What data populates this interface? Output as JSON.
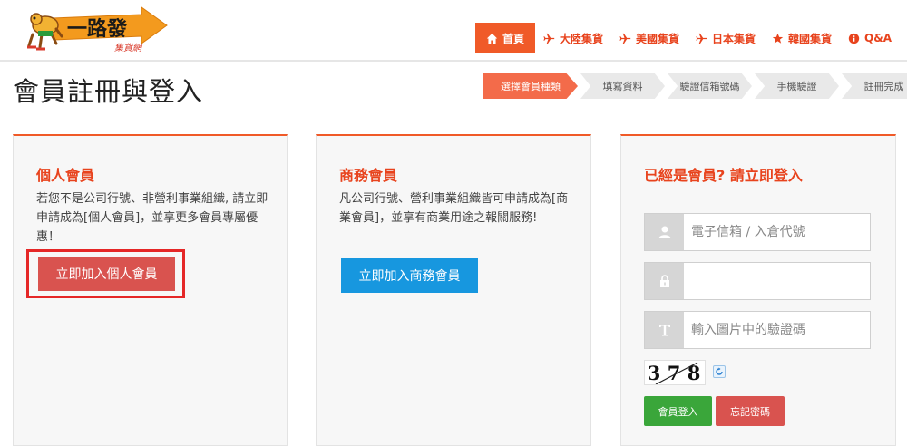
{
  "brand": {
    "logo_text": "一路發",
    "logo_subtext": "集貨網"
  },
  "nav": {
    "items": [
      {
        "label": "首頁",
        "icon": "home-icon",
        "active": true
      },
      {
        "label": "大陸集貨",
        "icon": "plane-icon",
        "active": false
      },
      {
        "label": "美國集貨",
        "icon": "plane-icon",
        "active": false
      },
      {
        "label": "日本集貨",
        "icon": "plane-icon",
        "active": false
      },
      {
        "label": "韓國集貨",
        "icon": "star-icon",
        "active": false
      },
      {
        "label": "Q&A",
        "icon": "info-icon",
        "active": false
      }
    ]
  },
  "page": {
    "title": "會員註冊與登入"
  },
  "steps": [
    {
      "label": "選擇會員種類",
      "active": true
    },
    {
      "label": "填寫資料",
      "active": false
    },
    {
      "label": "驗證信箱號碼",
      "active": false
    },
    {
      "label": "手機驗證",
      "active": false
    },
    {
      "label": "註冊完成",
      "active": false
    }
  ],
  "personal": {
    "title": "個人會員",
    "description": "若您不是公司行號、非營利事業組織, 請立即申請成為[個人會員]，並享更多會員專屬優惠！",
    "button_label": "立即加入個人會員"
  },
  "business": {
    "title": "商務會員",
    "description": "凡公司行號、營利事業組織皆可申請成為[商業會員]，並享有商業用途之報關服務!",
    "button_label": "立即加入商務會員"
  },
  "login": {
    "title": "已經是會員? 請立即登入",
    "email_placeholder": "電子信箱 / 入倉代號",
    "password_placeholder": "",
    "captcha_placeholder": "輸入圖片中的驗證碼",
    "captcha_code": [
      "3",
      "7",
      "8"
    ],
    "login_button": "會員登入",
    "forgot_button": "忘記密碼"
  },
  "colors": {
    "accent": "#f05a28",
    "accent_text": "#e8431d",
    "personal_button": "#d9534f",
    "business_button": "#1797df",
    "login_button": "#3aa63a",
    "forgot_button": "#d9534f",
    "highlight_border": "#e52727"
  }
}
